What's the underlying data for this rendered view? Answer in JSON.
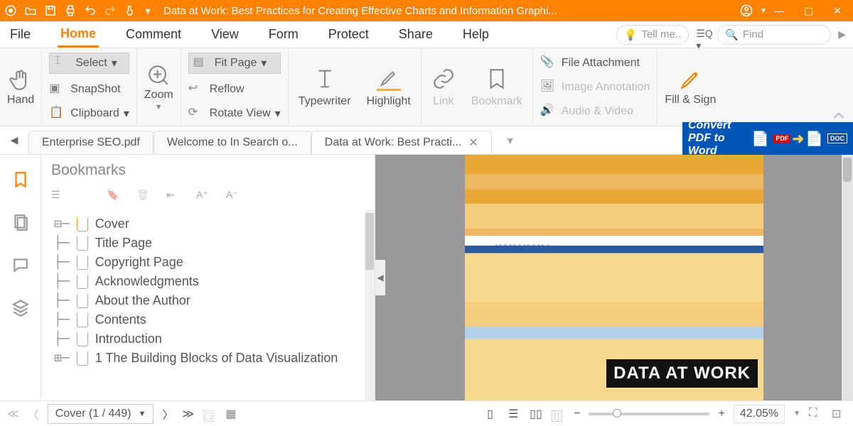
{
  "titlebar": {
    "title": "Data at Work: Best Practices for Creating Effective Charts and Information Graphi..."
  },
  "menu": {
    "tabs": [
      "File",
      "Home",
      "Comment",
      "View",
      "Form",
      "Protect",
      "Share",
      "Help"
    ],
    "active": 1,
    "tellme": "Tell me..",
    "find": "Find"
  },
  "ribbon": {
    "hand": "Hand",
    "select": "Select",
    "snapshot": "SnapShot",
    "clipboard": "Clipboard",
    "zoom": "Zoom",
    "fitpage": "Fit Page",
    "reflow": "Reflow",
    "rotate": "Rotate View",
    "typewriter": "Typewriter",
    "highlight": "Highlight",
    "link": "Link",
    "bookmark": "Bookmark",
    "fileatt": "File Attachment",
    "imgann": "Image Annotation",
    "audvid": "Audio & Video",
    "fillsign": "Fill & Sign"
  },
  "doctabs": {
    "tabs": [
      "Enterprise SEO.pdf",
      "Welcome to In Search o...",
      "Data at Work: Best Practi..."
    ],
    "active": 2
  },
  "ad": {
    "line1": "Convert",
    "line2": "PDF to Word"
  },
  "bookmarks": {
    "title": "Bookmarks",
    "items": [
      "Cover",
      "Title Page",
      "Copyright Page",
      "Acknowledgments",
      "About the Author",
      "Contents",
      "Introduction",
      "1 The Building Blocks of Data Visualization"
    ]
  },
  "page": {
    "numbers": "18.5   18.9   19.3   19.6",
    "title": "DATA AT WORK"
  },
  "status": {
    "page": "Cover (1 / 449)",
    "zoom": "42.05%"
  }
}
